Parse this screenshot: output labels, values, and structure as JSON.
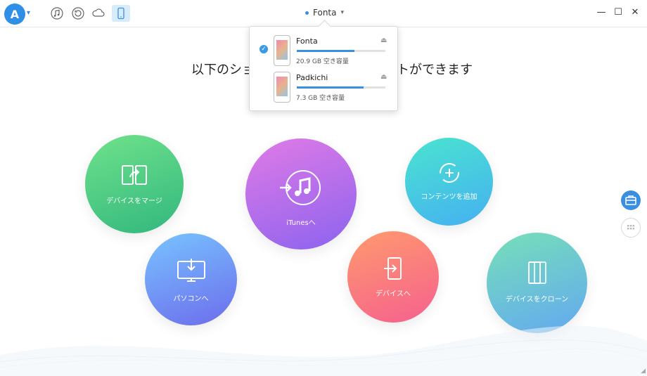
{
  "topbar": {
    "logo_text": "A",
    "icons": [
      "music-icon",
      "restore-icon",
      "cloud-icon",
      "phone-icon"
    ],
    "current_device": "Fonta",
    "window_controls": {
      "minimize": "—",
      "maximize": "☐",
      "close": "✕"
    }
  },
  "headline": {
    "left": "以下のショ",
    "right": "トができます"
  },
  "device_popup": {
    "devices": [
      {
        "name": "Fonta",
        "capacity": "20.9 GB 空き容量",
        "selected": true,
        "usage_fraction": 0.65
      },
      {
        "name": "Padkichi",
        "capacity": "7.3 GB 空き容量",
        "selected": false,
        "usage_fraction": 0.75
      }
    ]
  },
  "actions": [
    {
      "id": "merge",
      "label": "デバイスをマージ",
      "icon": "merge-icon"
    },
    {
      "id": "itunes",
      "label": "iTunesへ",
      "icon": "itunes-icon"
    },
    {
      "id": "add",
      "label": "コンテンツを追加",
      "icon": "add-icon"
    },
    {
      "id": "pc",
      "label": "パソコンへ",
      "icon": "computer-icon"
    },
    {
      "id": "device",
      "label": "デバイスへ",
      "icon": "device-transfer-icon"
    },
    {
      "id": "clone",
      "label": "デバイスをクローン",
      "icon": "clone-icon"
    }
  ],
  "colors": {
    "accent": "#3a8fe0",
    "merge": "#32b77e",
    "itunes": "#8c63ef",
    "add": "#45b0f2",
    "pc": "#6c6cec",
    "device": "#f5608e",
    "clone": "#63a8f2"
  }
}
